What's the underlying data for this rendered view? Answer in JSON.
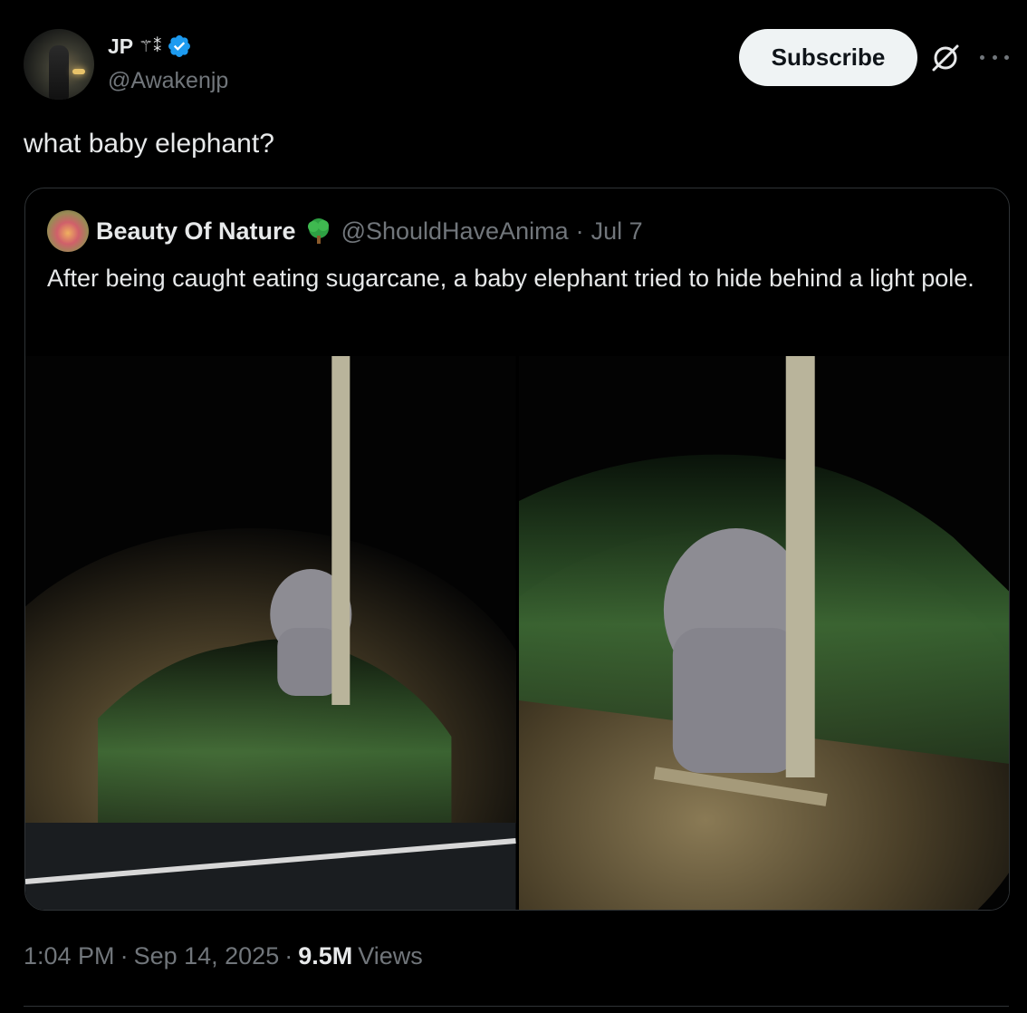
{
  "author": {
    "display_name": "JP",
    "name_glyphs": "⚚⁑",
    "handle": "@Awakenjp",
    "verified": true
  },
  "actions": {
    "subscribe_label": "Subscribe",
    "grok_icon": "grok-icon",
    "more_icon": "more-icon"
  },
  "tweet": {
    "text": "what baby elephant?"
  },
  "quoted": {
    "display_name": "Beauty Of Nature",
    "badge_icon": "tree-icon",
    "handle": "@ShouldHaveAnima",
    "separator": "·",
    "date": "Jul 7",
    "text": "After being caught eating sugarcane, a baby elephant tried to hide behind a light pole."
  },
  "meta": {
    "time": "1:04 PM",
    "sep1": "·",
    "date": "Sep 14, 2025",
    "sep2": "·",
    "views_count": "9.5M",
    "views_label": "Views"
  },
  "colors": {
    "background": "#000000",
    "text": "#e7e9ea",
    "secondary": "#71767b",
    "border": "#2f3336",
    "verified": "#1d9bf0",
    "tree": "#2ea043"
  }
}
